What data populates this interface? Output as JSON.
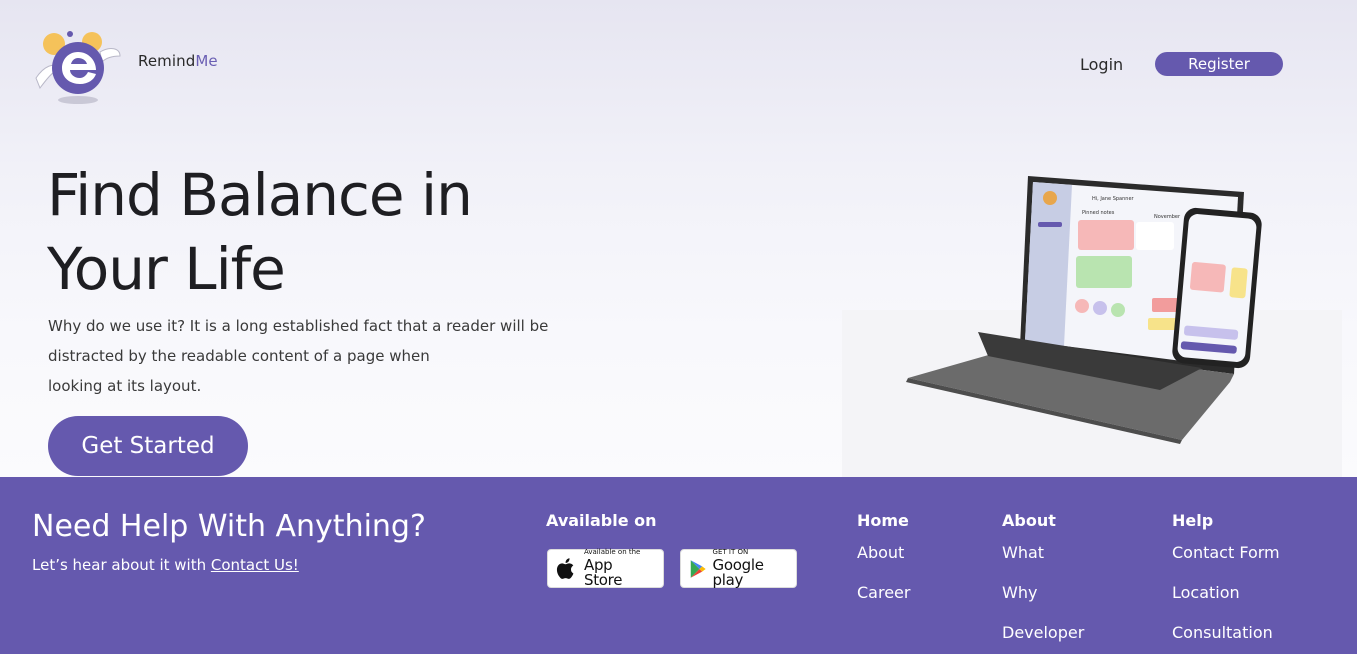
{
  "header": {
    "brand_name": "Remind",
    "brand_accent": "Me",
    "login_label": "Login",
    "register_label": "Register"
  },
  "hero": {
    "title_line1": "Find Balance in",
    "title_line2": "Your Life",
    "lead_line1": "Why do we use it? It is a long established fact that a reader will be",
    "lead_line2": "distracted by the readable content of a page when",
    "lead_line3": "looking at its layout.",
    "cta_label": "Get Started"
  },
  "mockup": {
    "greeting": "Hi, Jane Spanner",
    "section": "Pinned notes",
    "month": "November"
  },
  "footer": {
    "help_title": "Need Help With Anything?",
    "help_sub_prefix": "Let’s hear about it with ",
    "help_sub_link": "Contact Us!",
    "available_on": "Available on",
    "apple_small": "Available on the",
    "apple_big": "App Store",
    "google_small": "GET IT ON",
    "google_big": "Google play",
    "columns": [
      {
        "heading": "Home",
        "links": [
          "About",
          "Career"
        ]
      },
      {
        "heading": "About",
        "links": [
          "What",
          "Why",
          "Developer"
        ]
      },
      {
        "heading": "Help",
        "links": [
          "Contact Form",
          "Location",
          "Consultation"
        ]
      }
    ]
  },
  "colors": {
    "primary": "#6559ae",
    "hero_bg": "#f1f1f8",
    "text_dark": "#1e1e22"
  },
  "icons": [
    "app-logo-icon",
    "apple-icon",
    "google-play-icon"
  ]
}
